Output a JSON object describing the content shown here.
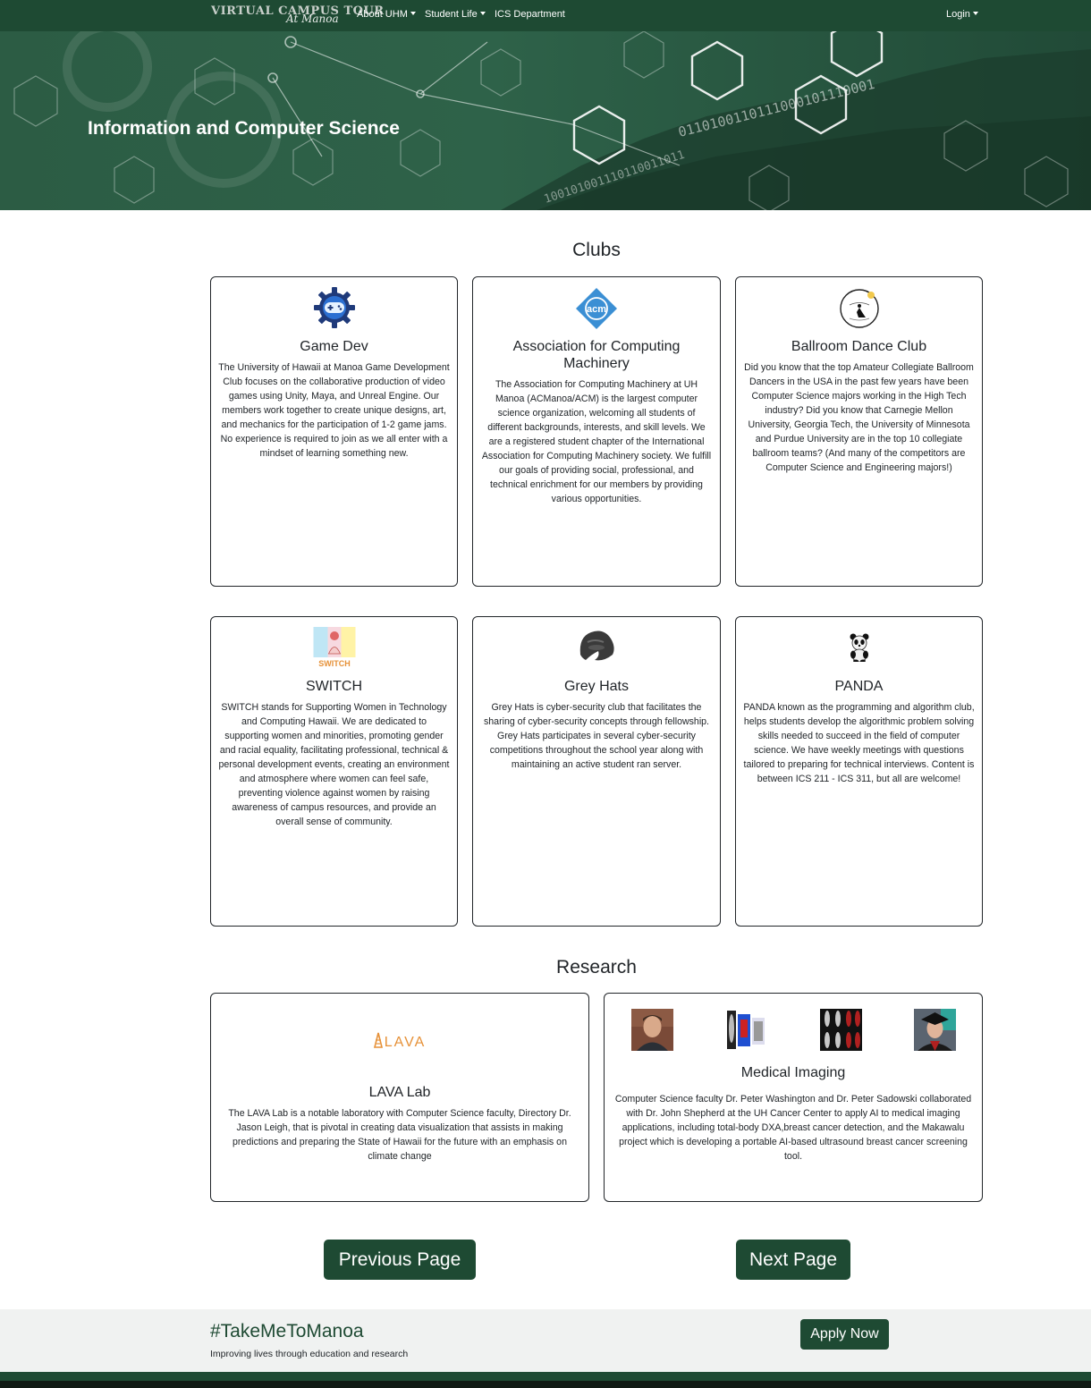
{
  "navbar": {
    "brand_line1": "VIRTUAL CAMPUS TOUR",
    "brand_line2": "At Manoa",
    "items": [
      {
        "label": "About UHM"
      },
      {
        "label": "Student Life"
      },
      {
        "label": "ICS Department"
      }
    ],
    "login_label": "Login"
  },
  "hero": {
    "title": "Information and Computer Science",
    "binary_text": "0110100110111000101110001",
    "binary_text2": "100101001110110011011"
  },
  "clubs": {
    "heading": "Clubs",
    "items": [
      {
        "title": "Game Dev",
        "icon": "gamepad-gear-icon",
        "text": "The University of Hawaii at Manoa Game Development Club focuses on the collaborative production of video games using Unity, Maya, and Unreal Engine. Our members work together to create unique designs, art, and mechanics for the participation of 1-2 game jams. No experience is required to join as we all enter with a mindset of learning something new."
      },
      {
        "title": "Association for Computing Machinery",
        "icon": "acm-logo-icon",
        "logo_text": "acm",
        "text": "The Association for Computing Machinery at UH Manoa (ACManoa/ACM) is the largest computer science organization, welcoming all students of different backgrounds, interests, and skill levels. We are a registered student chapter of the International Association for Computing Machinery society. We fulfill our goals of providing social, professional, and technical enrichment for our members by providing various opportunities."
      },
      {
        "title": "Ballroom Dance Club",
        "icon": "ballroom-logo-icon",
        "text": "Did you know that the top Amateur Collegiate Ballroom Dancers in the USA in the past few years have been Computer Science majors working in the High Tech industry? Did you know that Carnegie Mellon University, Georgia Tech, the University of Minnesota and Purdue University are in the top 10 collegiate ballroom teams? (And many of the competitors are Computer Science and Engineering majors!)"
      },
      {
        "title": "SWITCH",
        "icon": "switch-logo-icon",
        "logo_text": "SWITCH",
        "text": "SWITCH stands for Supporting Women in Technology and Computing Hawaii. We are dedicated to supporting women and minorities, promoting gender and racial equality, facilitating professional, technical & personal development events, creating an environment and atmosphere where women can feel safe, preventing violence against women by raising awareness of campus resources, and provide an overall sense of community."
      },
      {
        "title": "Grey Hats",
        "icon": "grey-hat-logo-icon",
        "text": "Grey Hats is cyber-security club that facilitates the sharing of cyber-security concepts through fellowship. Grey Hats participates in several cyber-security competitions throughout the school year along with maintaining an active student ran server."
      },
      {
        "title": "PANDA",
        "icon": "panda-logo-icon",
        "text": "PANDA known as the programming and algorithm club, helps students develop the algorithmic problem solving skills needed to succeed in the field of computer science. We have weekly meetings with questions tailored to preparing for technical interviews. Content is between ICS 211 - ICS 311, but all are welcome!"
      }
    ]
  },
  "research": {
    "heading": "Research",
    "items": [
      {
        "title": "LAVA Lab",
        "icon": "lava-logo-icon",
        "logo_text": "LAVA",
        "text": "The LAVA Lab is a notable laboratory with Computer Science faculty, Directory Dr. Jason Leigh, that is pivotal in creating data visualization that assists in making predictions and preparing the State of Hawaii for the future with an emphasis on climate change"
      },
      {
        "title": "Medical Imaging",
        "icon": "medical-images",
        "text": "Computer Science faculty Dr. Peter Washington and Dr. Peter Sadowski collaborated with Dr. John Shepherd at the UH Cancer Center to apply AI to medical imaging applications, including total-body DXA,breast cancer detection, and the Makawalu project which is developing a portable AI-based ultrasound breast cancer screening tool."
      }
    ]
  },
  "pagination": {
    "previous_label": "Previous Page",
    "next_label": "Next Page"
  },
  "footer": {
    "hashtag": "#TakeMeToManoa",
    "tagline": "Improving lives through education and research",
    "apply_label": "Apply Now"
  },
  "colors": {
    "brand_green": "#1e4a33",
    "hero_green": "#2e6249"
  }
}
